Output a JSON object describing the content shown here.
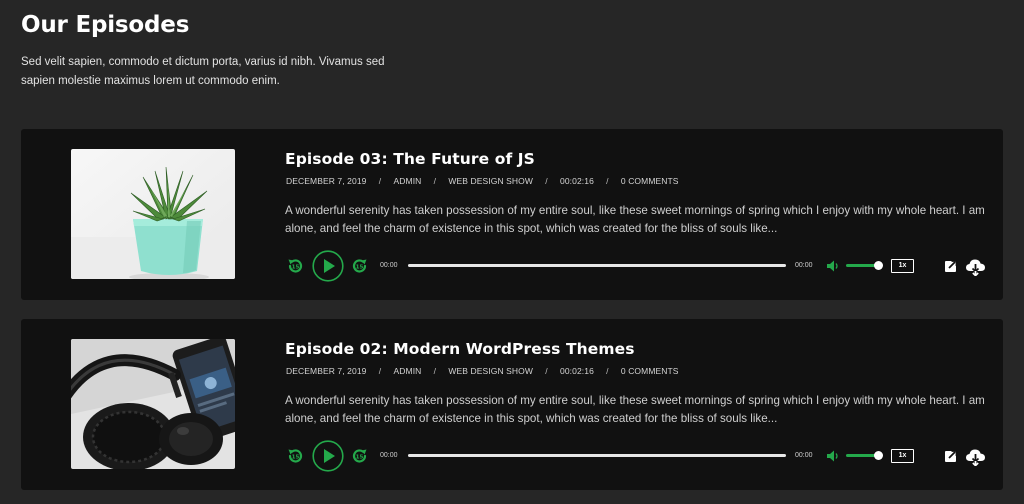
{
  "page": {
    "title": "Our Episodes",
    "intro": "Sed velit sapien, commodo et dictum porta, varius id nibh. Vivamus sed sapien molestie maximus lorem ut commodo enim."
  },
  "colors": {
    "background": "#262626",
    "card": "#111111",
    "accent": "#24a94b",
    "text": "#ffffff"
  },
  "episodes": [
    {
      "title": "Episode 03: The Future of JS",
      "date": "December 7, 2019",
      "author": "Admin",
      "show": "Web Design Show",
      "duration": "00:02:16",
      "comments": "0 Comments",
      "excerpt": "A wonderful serenity has taken possession of my entire soul, like these sweet mornings of spring which I enjoy with my whole heart. I am alone, and feel the charm of existence in this spot, which was created for the bliss of souls like...",
      "thumbnail_icon": "succulent-plant-image",
      "player": {
        "current_time": "00:00",
        "total_time": "00:00",
        "progress": 0,
        "volume": 1,
        "speed": "1x"
      }
    },
    {
      "title": "Episode 02: Modern WordPress Themes",
      "date": "December 7, 2019",
      "author": "Admin",
      "show": "Web Design Show",
      "duration": "00:02:16",
      "comments": "0 Comments",
      "excerpt": "A wonderful serenity has taken possession of my entire soul, like these sweet mornings of spring which I enjoy with my whole heart. I am alone, and feel the charm of existence in this spot, which was created for the bliss of souls like...",
      "thumbnail_icon": "headphones-phone-image",
      "player": {
        "current_time": "00:00",
        "total_time": "00:00",
        "progress": 0,
        "volume": 1,
        "speed": "1x"
      }
    }
  ],
  "icons": {
    "rewind": "rewind-15-icon",
    "play": "play-icon",
    "forward": "forward-15-icon",
    "volume": "volume-icon",
    "share": "share-icon",
    "download": "cloud-download-icon"
  }
}
